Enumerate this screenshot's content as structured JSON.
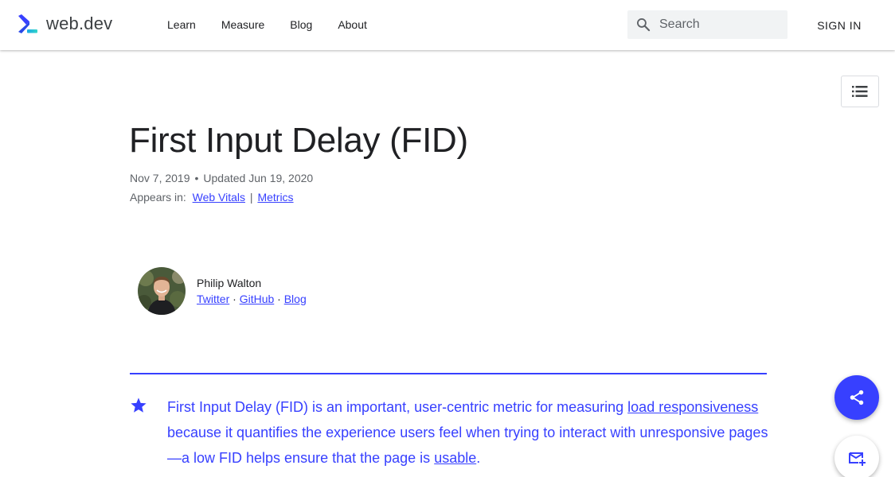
{
  "header": {
    "logo_text": "web.dev",
    "nav": [
      "Learn",
      "Measure",
      "Blog",
      "About"
    ],
    "search_placeholder": "Search",
    "signin_label": "SIGN IN"
  },
  "article": {
    "title": "First Input Delay (FID)",
    "date": "Nov 7, 2019",
    "updated": "Updated Jun 19, 2020",
    "appears_label": "Appears in:",
    "appears_links": [
      "Web Vitals",
      "Metrics"
    ],
    "appears_separator": "|"
  },
  "author": {
    "name": "Philip Walton",
    "links": [
      "Twitter",
      "GitHub",
      "Blog"
    ],
    "link_separator": "·"
  },
  "callout": {
    "part1": "First Input Delay (FID) is an important, user-centric metric for measuring ",
    "link1": "load responsiveness",
    "part2": " because it quantifies the experience users feel when trying to interact with unresponsive pages—a low FID helps ensure that the page is ",
    "link2": "usable",
    "part3": "."
  },
  "colors": {
    "accent": "#3740ff",
    "text": "#202124",
    "muted": "#5f6368"
  },
  "icons": [
    "web-dev-logo-icon",
    "search-icon",
    "table-of-contents-icon",
    "star-icon",
    "share-icon",
    "mail-subscribe-icon"
  ]
}
